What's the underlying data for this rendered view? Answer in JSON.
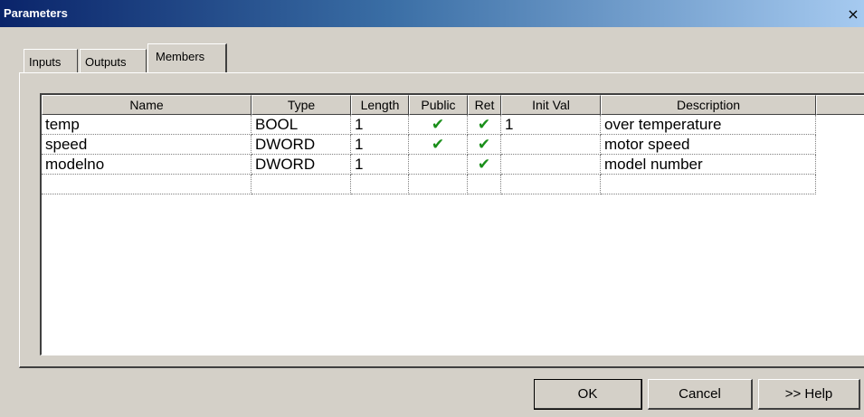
{
  "window": {
    "title": "Parameters",
    "close_glyph": "×"
  },
  "tabs": [
    {
      "label": "Inputs",
      "active": false
    },
    {
      "label": "Outputs",
      "active": false
    },
    {
      "label": "Members",
      "active": true
    }
  ],
  "table": {
    "columns": [
      "Name",
      "Type",
      "Length",
      "Public",
      "Ret",
      "Init Val",
      "Description"
    ],
    "rows": [
      {
        "name": "temp",
        "type": "BOOL",
        "length": "1",
        "public": "✔",
        "ret": "✔",
        "init_val": "1",
        "description": "over temperature"
      },
      {
        "name": "speed",
        "type": "DWORD",
        "length": "1",
        "public": "✔",
        "ret": "✔",
        "init_val": "",
        "description": "motor speed"
      },
      {
        "name": "modelno",
        "type": "DWORD",
        "length": "1",
        "public": "",
        "ret": "✔",
        "init_val": "",
        "description": "model number"
      },
      {
        "name": "",
        "type": "",
        "length": "",
        "public": "",
        "ret": "",
        "init_val": "",
        "description": ""
      }
    ]
  },
  "buttons": {
    "ok": "OK",
    "cancel": "Cancel",
    "help": ">> Help"
  },
  "colors": {
    "check": "#1a8f1a",
    "title_start": "#0a246a",
    "title_end": "#a6caf0",
    "face": "#d4d0c8"
  }
}
